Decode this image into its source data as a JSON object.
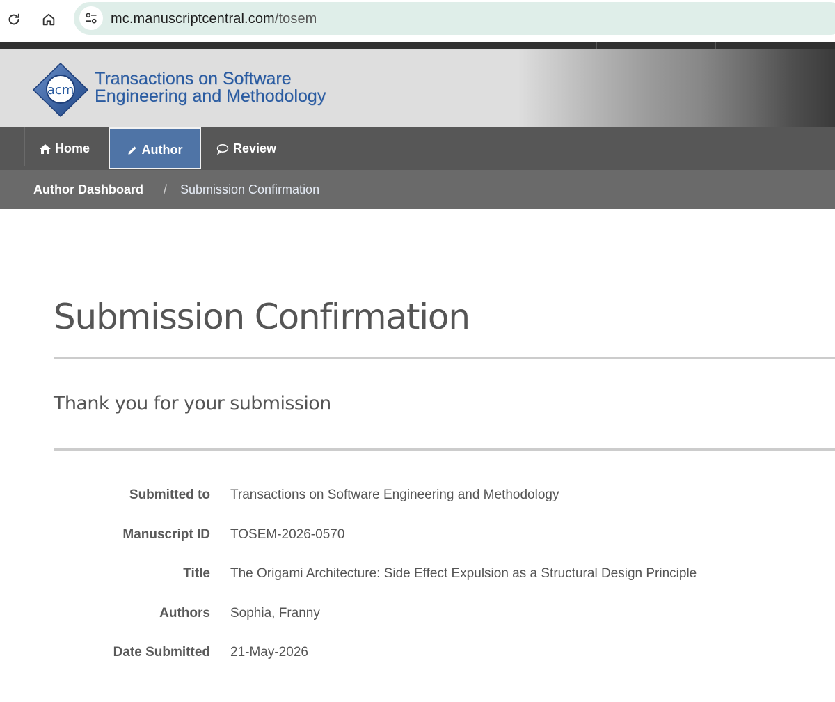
{
  "browser": {
    "url_host": "mc.manuscriptcentral.com",
    "url_path": "/tosem"
  },
  "banner": {
    "logo_text": "acm",
    "journal_line1": "Transactions on Software",
    "journal_line2": "Engineering and Methodology"
  },
  "nav": {
    "items": [
      {
        "label": "Home",
        "icon": "home-icon"
      },
      {
        "label": "Author",
        "icon": "pencil-icon",
        "active": true
      },
      {
        "label": "Review",
        "icon": "speech-bubble-icon"
      }
    ]
  },
  "breadcrumb": {
    "parent": "Author Dashboard",
    "separator": "/",
    "current": "Submission Confirmation"
  },
  "main": {
    "title": "Submission Confirmation",
    "subtitle": "Thank you for your submission",
    "details": [
      {
        "label": "Submitted to",
        "value": "Transactions on Software Engineering and Methodology"
      },
      {
        "label": "Manuscript ID",
        "value": "TOSEM-2026-0570"
      },
      {
        "label": "Title",
        "value": "The Origami Architecture: Side Effect Expulsion as a Structural Design Principle"
      },
      {
        "label": "Authors",
        "value": "Sophia, Franny"
      },
      {
        "label": "Date Submitted",
        "value": "21-May-2026"
      }
    ]
  },
  "colors": {
    "nav_bg": "#575757",
    "nav_active": "#4f74a6",
    "breadcrumb_bg": "#6a6a6a",
    "brand_blue": "#2a5ba0",
    "omnibox_bg": "#dfeee9"
  }
}
